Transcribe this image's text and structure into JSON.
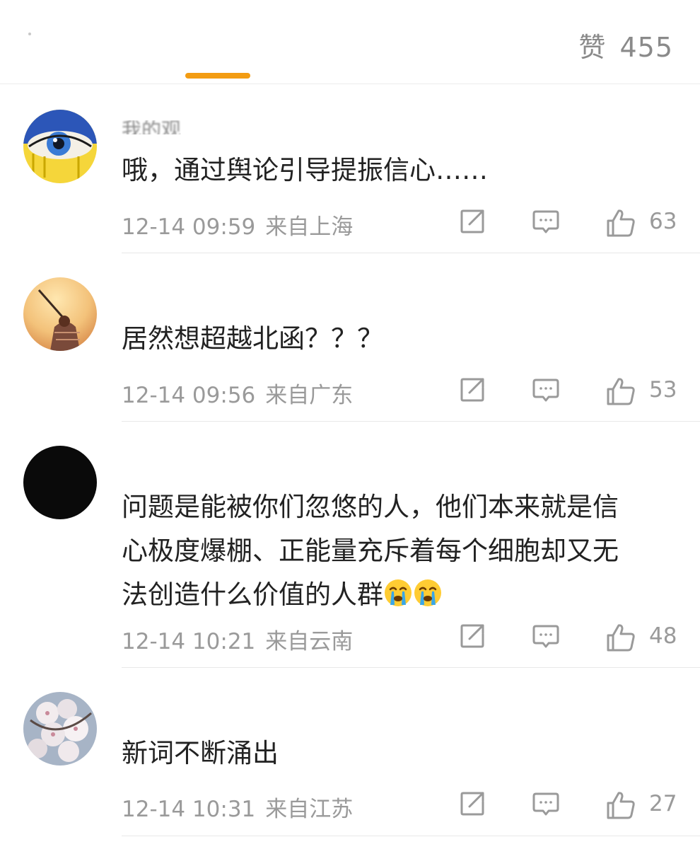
{
  "header": {
    "likes_label": "赞",
    "likes_count": "455"
  },
  "comments": [
    {
      "username": "我的观",
      "text": "哦，通过舆论引导提振信心……",
      "time": "12-14 09:59",
      "location": "来自上海",
      "likes": "63"
    },
    {
      "username": "",
      "text": "居然想超越北函？？？",
      "time": "12-14 09:56",
      "location": "来自广东",
      "likes": "53"
    },
    {
      "username": "",
      "text_lines": [
        "问题是能被你们忽悠的人，他们本来就是信",
        "心极度爆棚、正能量充斥着每个细胞却又无",
        "法创造什么价值的人群"
      ],
      "emoji": "crying-face-emoji",
      "time": "12-14 10:21",
      "location": "来自云南",
      "likes": "48"
    },
    {
      "username": "",
      "text": "新词不断涌出",
      "time": "12-14 10:31",
      "location": "来自江苏",
      "likes": "27"
    }
  ],
  "icons": {
    "share": "share-icon",
    "reply": "comment-icon",
    "like": "thumbs-up-icon"
  },
  "colors": {
    "accent": "#f39c12",
    "meta_text": "#9a9a9a",
    "body_text": "#222222"
  }
}
